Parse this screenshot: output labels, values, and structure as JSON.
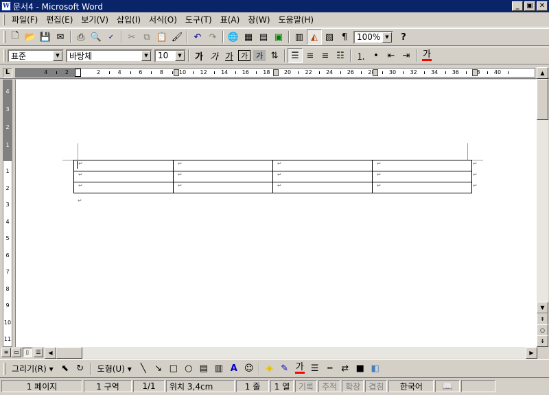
{
  "window": {
    "title": "문서4 - Microsoft Word",
    "app_icon_label": "W",
    "buttons": {
      "minimize": "_",
      "maximize": "▣",
      "close": "✕"
    }
  },
  "menu": {
    "items": [
      "파일(F)",
      "편집(E)",
      "보기(V)",
      "삽입(I)",
      "서식(O)",
      "도구(T)",
      "표(A)",
      "창(W)",
      "도움말(H)"
    ]
  },
  "standard_toolbar": {
    "zoom": "100%",
    "help_label": "?"
  },
  "formatting_toolbar": {
    "style": "표준",
    "font": "바탕체",
    "size": "10",
    "bold_label": "가",
    "italic_label": "가",
    "underline_label": "가",
    "char_border_label": "가",
    "char_shading_label": "가",
    "font_color_label": "가"
  },
  "ruler": {
    "labels": [
      "4",
      "2",
      "2",
      "4",
      "6",
      "8",
      "10",
      "12",
      "14",
      "16",
      "18",
      "20",
      "22",
      "24",
      "26",
      "28",
      "30",
      "32",
      "34",
      "36",
      "38",
      "40"
    ],
    "corner": "L"
  },
  "vertical_ruler": {
    "labels": [
      "4",
      "3",
      "2",
      "1",
      "1",
      "2",
      "3",
      "4",
      "5",
      "6",
      "7",
      "8",
      "9",
      "10",
      "11"
    ]
  },
  "document": {
    "rows": 3,
    "cols": 4,
    "cell_mark": "↵",
    "paragraph_mark": "↵"
  },
  "draw_toolbar": {
    "draw_label": "그리기(R)",
    "autoshapes_label": "도형(U)",
    "font_color_label": "가"
  },
  "status": {
    "page": "1 페이지",
    "section": "1 구역",
    "page_of": "1/1",
    "position": "위치 3,4cm",
    "line": "1 줄",
    "column": "1 열",
    "rec": "기록",
    "trk": "추적",
    "ext": "확장",
    "ovr": "겹침",
    "language": "한국어"
  }
}
